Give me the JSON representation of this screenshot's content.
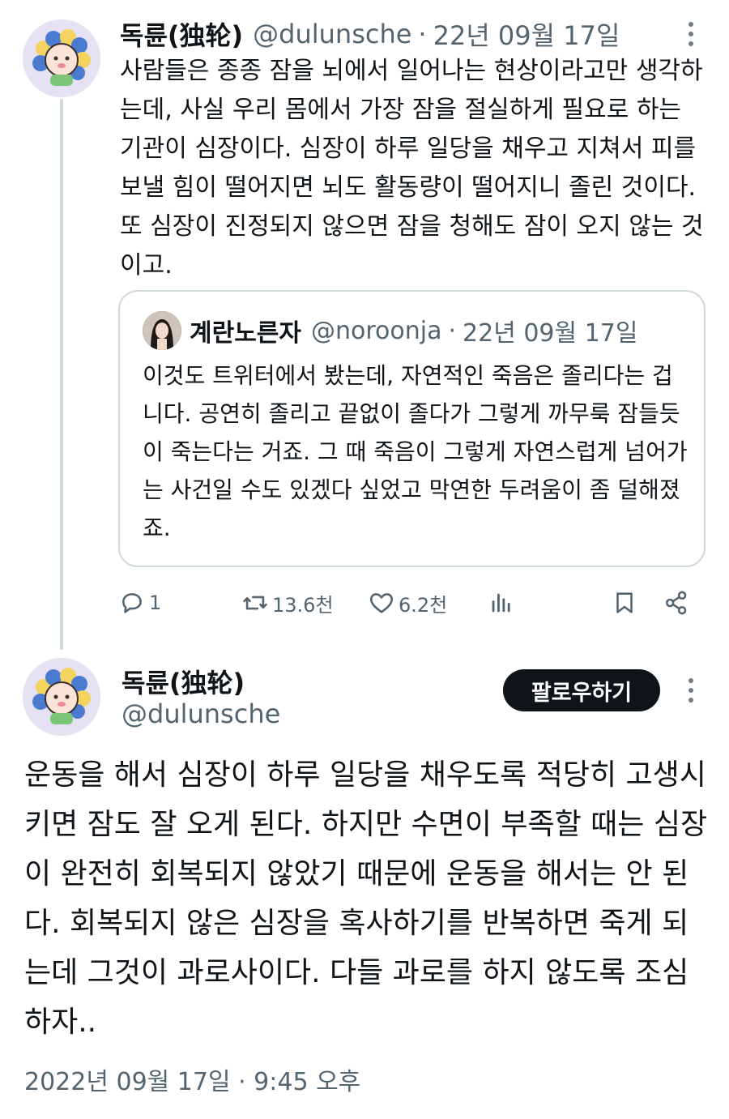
{
  "reply_tweet": {
    "author_name": "독륜(独轮)",
    "handle": "@dulunsche",
    "separator": "·",
    "date": "22년 09월 17일",
    "text": "사람들은 종종 잠을 뇌에서 일어나는 현상이라고만 생각하는데, 사실 우리 몸에서 가장 잠을 절실하게 필요로 하는 기관이 심장이다. 심장이 하루 일당을 채우고 지쳐서 피를 보낼 힘이 떨어지면 뇌도 활동량이 떨어지니 졸린 것이다. 또 심장이 진정되지 않으면 잠을 청해도 잠이 오지 않는 것이고.",
    "quoted_tweet": {
      "author_name": "계란노른자",
      "handle": "@noroonja",
      "separator": "·",
      "date": "22년 09월 17일",
      "text": "이것도 트위터에서 봤는데, 자연적인 죽음은 졸리다는 겁니다. 공연히 졸리고 끝없이 졸다가 그렇게 까무룩 잠들듯이 죽는다는 거죠. 그 때 죽음이 그렇게 자연스럽게 넘어가는 사건일 수도 있겠다 싶었고 막연한 두려움이 좀 덜해졌죠."
    },
    "actions": {
      "reply_count": "1",
      "retweet_count": "13.6천",
      "like_count": "6.2천"
    }
  },
  "main_tweet": {
    "author_name": "독륜(独轮)",
    "handle": "@dulunsche",
    "follow_label": "팔로우하기",
    "text": "운동을 해서 심장이 하루 일당을 채우도록 적당히 고생시키면 잠도 잘 오게 된다. 하지만 수면이 부족할 때는 심장이 완전히 회복되지 않았기 때문에 운동을 해서는 안 된다. 회복되지 않은 심장을 혹사하기를 반복하면 죽게 되는데 그것이 과로사이다. 다들 과로를 하지 않도록 조심하자..",
    "timestamp": "2022년 09월 17일 · 9:45 오후"
  },
  "icons": {
    "reply": "speech-bubble-icon",
    "retweet": "retweet-arrows-icon",
    "like": "heart-icon",
    "views": "bar-chart-icon",
    "bookmark": "bookmark-icon",
    "share": "share-icon",
    "more": "more-dots-vertical-icon"
  },
  "colors": {
    "text_primary": "#0f1419",
    "text_secondary": "#536471",
    "border": "#cfd9de",
    "follow_button_bg": "#0f1419",
    "avatar_bg": "#e7e1f4"
  }
}
